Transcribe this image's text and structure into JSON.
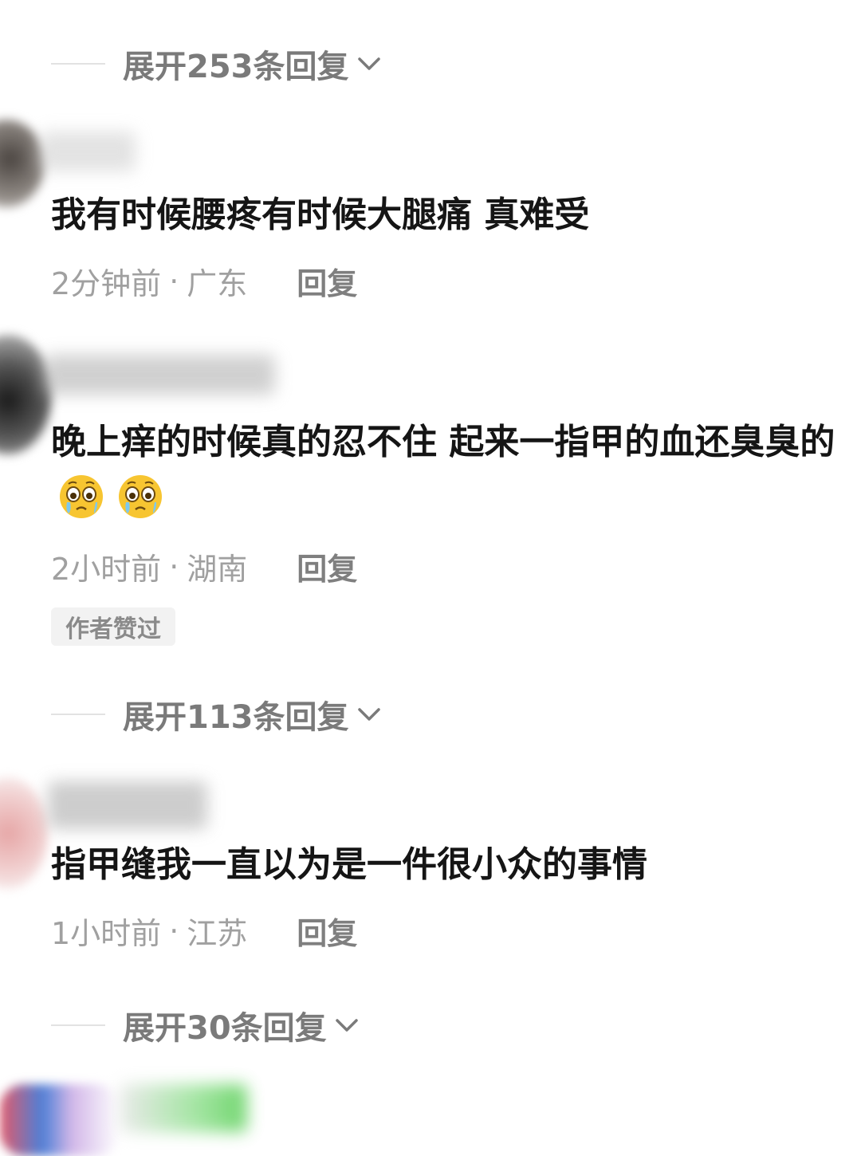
{
  "threads": [
    {
      "expand_label": "展开253条回复",
      "comment": "我有时候腰疼有时候大腿痛 真难受",
      "time": "2分钟前",
      "location": "广东",
      "reply_label": "回复"
    },
    {
      "comment": "晚上痒的时候真的忍不住 起来一指甲的血还臭臭的",
      "emojis": [
        "pleading-crying-face",
        "pleading-crying-face"
      ],
      "time": "2小时前",
      "location": "湖南",
      "reply_label": "回复",
      "tag": "作者赞过",
      "expand_label": "展开113条回复"
    },
    {
      "comment": "指甲缝我一直以为是一件很小众的事情",
      "time": "1小时前",
      "location": "江苏",
      "reply_label": "回复",
      "expand_label": "展开30条回复"
    }
  ],
  "meta_separator": "·",
  "colors": {
    "text": "#151515",
    "meta": "#a0a0a0",
    "expand": "#7a7a7a",
    "emoji_face": "#f7c531"
  }
}
